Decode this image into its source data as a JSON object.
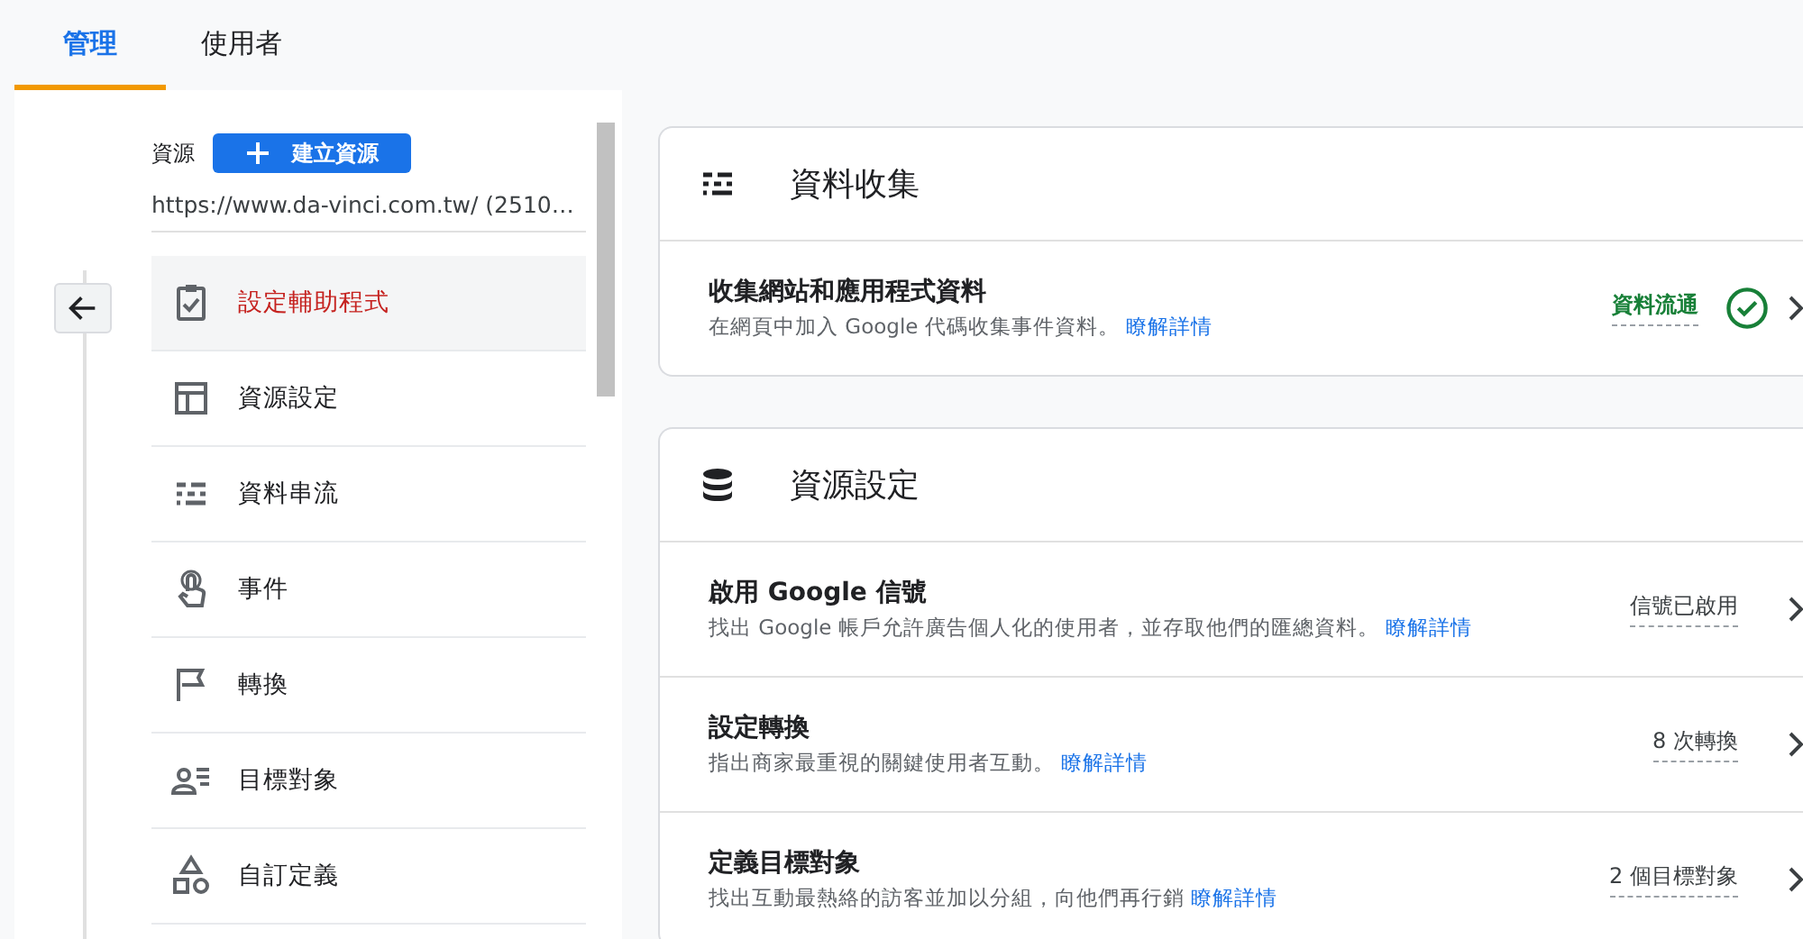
{
  "tabs": [
    {
      "label": "管理",
      "selected": true
    },
    {
      "label": "使用者",
      "selected": false
    }
  ],
  "property": {
    "label": "資源",
    "create_button": "建立資源",
    "name": "https://www.da-vinci.com.tw/ (2510…"
  },
  "nav": [
    {
      "label": "設定輔助程式",
      "selected": true
    },
    {
      "label": "資源設定",
      "selected": false
    },
    {
      "label": "資料串流",
      "selected": false
    },
    {
      "label": "事件",
      "selected": false
    },
    {
      "label": "轉換",
      "selected": false
    },
    {
      "label": "目標對象",
      "selected": false
    },
    {
      "label": "自訂定義",
      "selected": false
    }
  ],
  "sections": [
    {
      "title": "資料收集",
      "rows": [
        {
          "title": "收集網站和應用程式資料",
          "description": "在網頁中加入 Google 代碼收集事件資料。",
          "link": "瞭解詳情",
          "status": "資料流通",
          "kind": "success"
        }
      ]
    },
    {
      "title": "資源設定",
      "rows": [
        {
          "title": "啟用 Google 信號",
          "description": "找出 Google 帳戶允許廣告個人化的使用者，並存取他們的匯總資料。",
          "link": "瞭解詳情",
          "status": "信號已啟用",
          "kind": "neutral"
        },
        {
          "title": "設定轉換",
          "description": "指出商家最重視的關鍵使用者互動。",
          "link": "瞭解詳情",
          "status": "8 次轉換",
          "kind": "neutral"
        },
        {
          "title": "定義目標對象",
          "description": "找出互動最熱絡的訪客並加以分組，向他們再行銷",
          "link": "瞭解詳情",
          "status": "2 個目標對象",
          "kind": "neutral"
        }
      ]
    }
  ]
}
